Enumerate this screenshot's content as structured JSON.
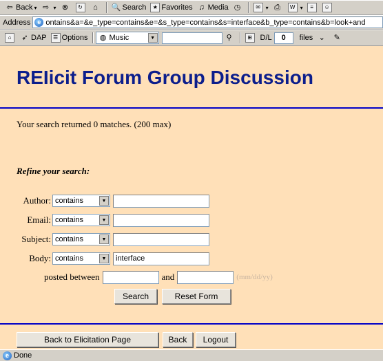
{
  "browser": {
    "toolbar": {
      "back_label": "Back",
      "search_label": "Search",
      "favorites_label": "Favorites",
      "media_label": "Media"
    },
    "address": {
      "label": "Address",
      "url": "ontains&a=&e_type=contains&e=&s_type=contains&s=interface&b_type=contains&b=look+and"
    },
    "links": {
      "dap_label": "DAP",
      "options_label": "Options",
      "music_label": "Music",
      "dl_label": "D/L",
      "dl_count": "0",
      "files_label": "files"
    },
    "status": {
      "text": "Done"
    }
  },
  "page": {
    "title": "REIicit Forum Group Discussion",
    "results_text": "Your search returned 0 matches. (200 max)",
    "refine_heading": "Refine your search:",
    "form": {
      "fields": [
        {
          "label": "Author:",
          "mode": "contains",
          "value": ""
        },
        {
          "label": "Email:",
          "mode": "contains",
          "value": ""
        },
        {
          "label": "Subject:",
          "mode": "contains",
          "value": ""
        },
        {
          "label": "Body:",
          "mode": "contains",
          "value": "interface"
        }
      ],
      "posted_between_label": "posted between",
      "and_label": "and",
      "date_hint": "(mm/dd/yy)",
      "search_button": "Search",
      "reset_button": "Reset Form"
    },
    "footer": {
      "back_to_elicitation": "Back to Elicitation Page",
      "back": "Back",
      "logout": "Logout"
    }
  }
}
